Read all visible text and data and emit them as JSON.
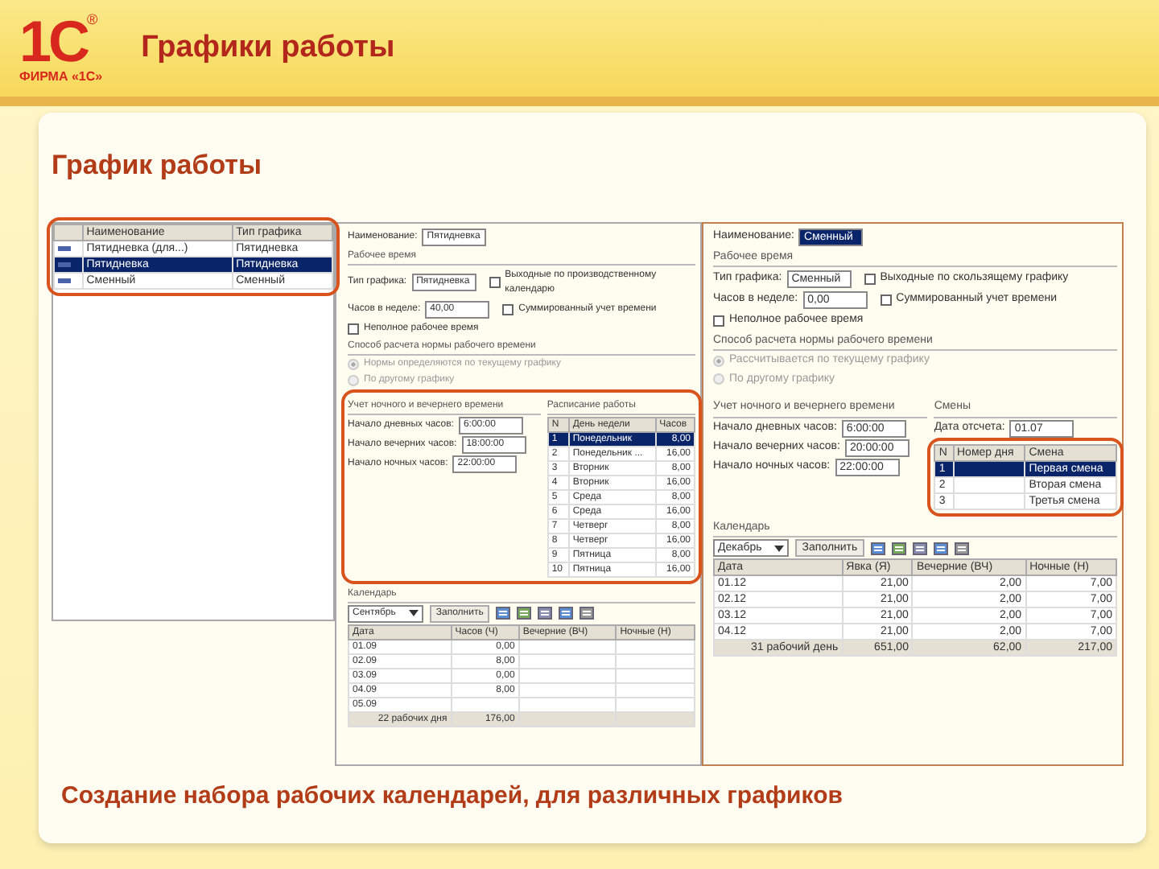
{
  "header": {
    "title": "Графики работы",
    "logo": {
      "mark": "1С",
      "registered": "®",
      "caption": "ФИРМА «1С»"
    }
  },
  "subtitle": "График работы",
  "panels": [
    {
      "kind": "list",
      "columns": [
        "Наименование",
        "Тип графика"
      ],
      "rows": [
        {
          "cells": [
            "Пятидневка (для...)",
            "Пятидневка"
          ],
          "selected": false
        },
        {
          "cells": [
            "Пятидневка",
            "Пятидневка"
          ],
          "selected": true
        },
        {
          "cells": [
            "Сменный",
            "Сменный"
          ],
          "selected": false
        }
      ]
    },
    {
      "kind": "form",
      "items": [
        {
          "kind": "field",
          "label": "Наименование:",
          "value": "Пятидневка",
          "selected": false
        },
        {
          "kind": "section",
          "label": "Рабочее время"
        },
        {
          "kind": "row",
          "items": [
            {
              "kind": "field",
              "label": "Тип графика:",
              "value": "Пятидневка",
              "selected": false
            },
            {
              "kind": "checkbox",
              "label": "Выходные по производственному календарю",
              "checked": false
            }
          ]
        },
        {
          "kind": "row",
          "items": [
            {
              "kind": "field",
              "label": "Часов в неделе:",
              "value": "40,00",
              "selected": false
            },
            {
              "kind": "checkbox",
              "label": "Суммированный учет времени",
              "checked": false
            }
          ]
        },
        {
          "kind": "checkbox",
          "label": "Неполное рабочее время",
          "checked": false
        },
        {
          "kind": "section",
          "label": "Способ расчета нормы рабочего времени"
        },
        {
          "kind": "radio",
          "label": "Нормы определяются по текущему графику",
          "selected": true,
          "disabled": true
        },
        {
          "kind": "radio",
          "label": "По другому графику",
          "selected": false,
          "disabled": true
        },
        {
          "kind": "columns",
          "groups": [
            {
              "items": [
                {
                  "kind": "section",
                  "label": "Учет ночного и вечернего времени"
                },
                {
                  "kind": "field",
                  "label": "Начало дневных часов:",
                  "value": "6:00:00",
                  "selected": false
                },
                {
                  "kind": "field",
                  "label": "Начало вечерних часов:",
                  "value": "18:00:00",
                  "selected": false
                },
                {
                  "kind": "field",
                  "label": "Начало ночных часов:",
                  "value": "22:00:00",
                  "selected": false
                }
              ]
            },
            {
              "items": [
                {
                  "kind": "section",
                  "label": "Расписание работы"
                },
                {
                  "kind": "table",
                  "columns": [
                    "N",
                    "День недели",
                    "Часов"
                  ],
                  "rows": [
                    {
                      "cells": [
                        "1",
                        "Понедельник",
                        "8,00"
                      ],
                      "selected": true
                    },
                    {
                      "cells": [
                        "2",
                        "Понедельник ...",
                        "16,00"
                      ],
                      "selected": false
                    },
                    {
                      "cells": [
                        "3",
                        "Вторник",
                        "8,00"
                      ],
                      "selected": false
                    },
                    {
                      "cells": [
                        "4",
                        "Вторник",
                        "16,00"
                      ],
                      "selected": false
                    },
                    {
                      "cells": [
                        "5",
                        "Среда",
                        "8,00"
                      ],
                      "selected": false
                    },
                    {
                      "cells": [
                        "6",
                        "Среда",
                        "16,00"
                      ],
                      "selected": false
                    },
                    {
                      "cells": [
                        "7",
                        "Четверг",
                        "8,00"
                      ],
                      "selected": false
                    },
                    {
                      "cells": [
                        "8",
                        "Четверг",
                        "16,00"
                      ],
                      "selected": false
                    },
                    {
                      "cells": [
                        "9",
                        "Пятница",
                        "8,00"
                      ],
                      "selected": false
                    },
                    {
                      "cells": [
                        "10",
                        "Пятница",
                        "16,00"
                      ],
                      "selected": false
                    }
                  ]
                }
              ]
            }
          ]
        },
        {
          "kind": "section",
          "label": "Календарь"
        },
        {
          "kind": "toolbar",
          "month": "Сентябрь",
          "button": "Заполнить"
        },
        {
          "kind": "table",
          "columns": [
            "Дата",
            "Часов (Ч)",
            "Вечерние (ВЧ)",
            "Ночные (Н)"
          ],
          "rows": [
            {
              "cells": [
                "01.09",
                "0,00",
                null,
                null
              ],
              "selected": false
            },
            {
              "cells": [
                "02.09",
                "8,00",
                null,
                null
              ],
              "selected": false
            },
            {
              "cells": [
                "03.09",
                "0,00",
                null,
                null
              ],
              "selected": false
            },
            {
              "cells": [
                "04.09",
                "8,00",
                null,
                null
              ],
              "selected": false
            },
            {
              "cells": [
                "05.09",
                null,
                null,
                null
              ],
              "selected": false
            }
          ],
          "footer": [
            "22 рабочих дня",
            "176,00"
          ]
        }
      ]
    },
    {
      "kind": "form",
      "items": [
        {
          "kind": "field",
          "label": "Наименование:",
          "value": "Сменный",
          "selected": true
        },
        {
          "kind": "section",
          "label": "Рабочее время"
        },
        {
          "kind": "row",
          "items": [
            {
              "kind": "field",
              "label": "Тип графика:",
              "value": "Сменный",
              "selected": false
            },
            {
              "kind": "checkbox",
              "label": "Выходные по скользящему графику",
              "checked": false
            }
          ]
        },
        {
          "kind": "row",
          "items": [
            {
              "kind": "field",
              "label": "Часов в неделе:",
              "value": "0,00",
              "selected": false
            },
            {
              "kind": "checkbox",
              "label": "Суммированный учет времени",
              "checked": false
            }
          ]
        },
        {
          "kind": "checkbox",
          "label": "Неполное рабочее время",
          "checked": false
        },
        {
          "kind": "section",
          "label": "Способ расчета нормы рабочего времени"
        },
        {
          "kind": "radio",
          "label": "Рассчитывается по текущему графику",
          "selected": true,
          "disabled": true
        },
        {
          "kind": "radio",
          "label": "По другому графику",
          "selected": false,
          "disabled": true
        },
        {
          "kind": "columns",
          "groups": [
            {
              "items": [
                {
                  "kind": "section",
                  "label": "Учет ночного и вечернего времени"
                },
                {
                  "kind": "field",
                  "label": "Начало дневных часов:",
                  "value": "6:00:00",
                  "selected": false
                },
                {
                  "kind": "field",
                  "label": "Начало вечерних часов:",
                  "value": "20:00:00",
                  "selected": false
                },
                {
                  "kind": "field",
                  "label": "Начало ночных часов:",
                  "value": "22:00:00",
                  "selected": false
                }
              ]
            },
            {
              "items": [
                {
                  "kind": "section",
                  "label": "Смены"
                },
                {
                  "kind": "field",
                  "label": "Дата отсчета:",
                  "value": "01.07",
                  "selected": false
                },
                {
                  "kind": "table",
                  "columns": [
                    "N",
                    "Номер дня",
                    "Смена"
                  ],
                  "rows": [
                    {
                      "cells": [
                        "1",
                        null,
                        "Первая смена"
                      ],
                      "selected": true
                    },
                    {
                      "cells": [
                        "2",
                        null,
                        "Вторая смена"
                      ],
                      "selected": false
                    },
                    {
                      "cells": [
                        "3",
                        null,
                        "Третья смена"
                      ],
                      "selected": false
                    }
                  ]
                }
              ]
            }
          ]
        },
        {
          "kind": "section",
          "label": "Календарь"
        },
        {
          "kind": "toolbar",
          "month": "Декабрь",
          "button": "Заполнить"
        },
        {
          "kind": "table",
          "columns": [
            "Дата",
            "Явка (Я)",
            "Вечерние (ВЧ)",
            "Ночные (Н)"
          ],
          "rows": [
            {
              "cells": [
                "01.12",
                "21,00",
                "2,00",
                "7,00"
              ],
              "selected": false
            },
            {
              "cells": [
                "02.12",
                "21,00",
                "2,00",
                "7,00"
              ],
              "selected": false
            },
            {
              "cells": [
                "03.12",
                "21,00",
                "2,00",
                "7,00"
              ],
              "selected": false
            },
            {
              "cells": [
                "04.12",
                "21,00",
                "2,00",
                "7,00"
              ],
              "selected": false
            }
          ],
          "footer": [
            "31 рабочий день",
            "651,00",
            "62,00",
            "217,00"
          ]
        }
      ]
    }
  ],
  "caption": "Создание набора рабочих календарей, для различных графиков"
}
